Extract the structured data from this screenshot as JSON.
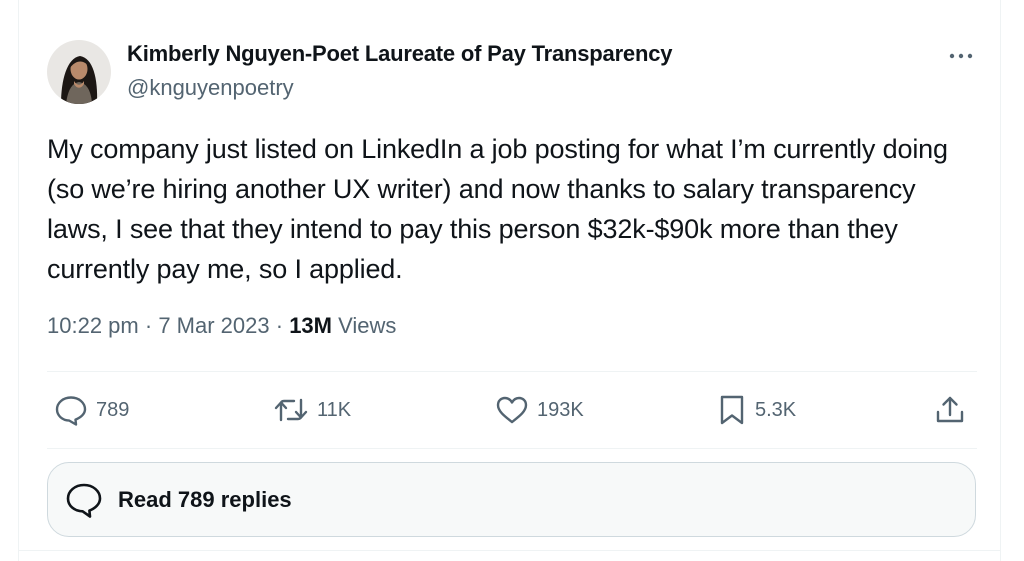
{
  "author": {
    "name": "Kimberly Nguyen-Poet Laureate of Pay Transparency",
    "handle": "@knguyenpoetry"
  },
  "tweet": {
    "text": "My company just listed on LinkedIn a job posting for what I’m currently doing (so we’re hiring another UX writer) and now thanks to salary transparency laws, I see that they intend to pay this person $32k-$90k more than they currently pay me, so I applied.",
    "time": "10:22 pm",
    "date": "7 Mar 2023",
    "separator": "·",
    "views_count": "13M",
    "views_label": "Views"
  },
  "actions": {
    "replies": "789",
    "reposts": "11K",
    "likes": "193K",
    "bookmarks": "5.3K"
  },
  "read_replies_label": "Read 789 replies",
  "icons": {
    "more": "more-horizontal-icon",
    "reply": "speech-bubble-icon",
    "repost": "repost-arrows-icon",
    "like": "heart-icon",
    "bookmark": "bookmark-icon",
    "share": "share-upload-icon",
    "replies_bubble": "speech-bubble-icon"
  },
  "colors": {
    "text": "#0f1419",
    "secondary": "#536471",
    "border": "#eff3f4",
    "button_border": "#cfd9de",
    "button_bg": "#f7f9f9"
  }
}
